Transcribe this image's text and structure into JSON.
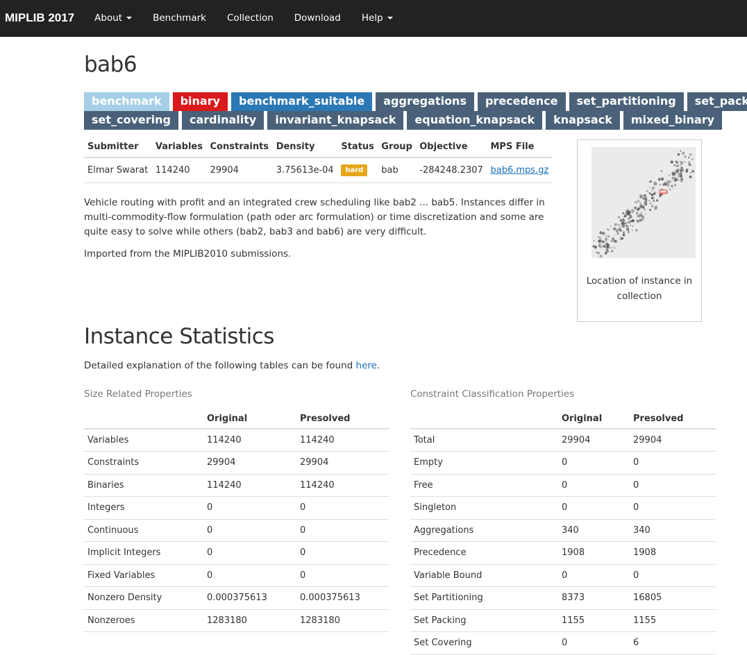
{
  "nav": {
    "brand": "MIPLIB 2017",
    "items": [
      {
        "label": "About",
        "dropdown": true
      },
      {
        "label": "Benchmark",
        "dropdown": false
      },
      {
        "label": "Collection",
        "dropdown": false
      },
      {
        "label": "Download",
        "dropdown": false
      },
      {
        "label": "Help",
        "dropdown": true
      }
    ]
  },
  "title": "bab6",
  "tags": [
    [
      {
        "label": "benchmark",
        "color": "#a4cfe6"
      },
      {
        "label": "binary",
        "color": "#d9191c"
      },
      {
        "label": "benchmark_suitable",
        "color": "#2a78b5"
      },
      {
        "label": "aggregations",
        "color": "#4a6179"
      },
      {
        "label": "precedence",
        "color": "#4a6179"
      },
      {
        "label": "set_partitioning",
        "color": "#4a6179"
      },
      {
        "label": "set_packing",
        "color": "#4a6179"
      }
    ],
    [
      {
        "label": "set_covering",
        "color": "#4a6179"
      },
      {
        "label": "cardinality",
        "color": "#4a6179"
      },
      {
        "label": "invariant_knapsack",
        "color": "#4a6179"
      },
      {
        "label": "equation_knapsack",
        "color": "#4a6179"
      },
      {
        "label": "knapsack",
        "color": "#4a6179"
      },
      {
        "label": "mixed_binary",
        "color": "#4a6179"
      }
    ]
  ],
  "info": {
    "headers": [
      "Submitter",
      "Variables",
      "Constraints",
      "Density",
      "Status",
      "Group",
      "Objective",
      "MPS File"
    ],
    "row": {
      "submitter": "Elmar Swarat",
      "variables": "114240",
      "constraints": "29904",
      "density": "3.75613e-04",
      "status": "hard",
      "group": "bab",
      "objective": "-284248.2307",
      "mps": "bab6.mps.gz"
    }
  },
  "description": [
    "Vehicle routing with profit and an integrated crew scheduling like bab2 ... bab5. Instances differ in multi-commodity-flow formulation (path oder arc formulation) or time discretization and some are quite easy to solve while others (bab2, bab3 and bab6) are very difficult.",
    "Imported from the MIPLIB2010 submissions."
  ],
  "figure": {
    "caption": "Location of instance in collection",
    "highlight_label": "bab6"
  },
  "stats_section": {
    "heading": "Instance Statistics",
    "explain_prefix": "Detailed explanation of the following tables can be found ",
    "explain_link": "here",
    "explain_suffix": "."
  },
  "size_table": {
    "label": "Size Related Properties",
    "headers": [
      "",
      "Original",
      "Presolved"
    ],
    "rows": [
      [
        "Variables",
        "114240",
        "114240"
      ],
      [
        "Constraints",
        "29904",
        "29904"
      ],
      [
        "Binaries",
        "114240",
        "114240"
      ],
      [
        "Integers",
        "0",
        "0"
      ],
      [
        "Continuous",
        "0",
        "0"
      ],
      [
        "Implicit Integers",
        "0",
        "0"
      ],
      [
        "Fixed Variables",
        "0",
        "0"
      ],
      [
        "Nonzero Density",
        "0.000375613",
        "0.000375613"
      ],
      [
        "Nonzeroes",
        "1283180",
        "1283180"
      ]
    ]
  },
  "constraint_table": {
    "label": "Constraint Classification Properties",
    "headers": [
      "",
      "Original",
      "Presolved"
    ],
    "rows": [
      [
        "Total",
        "29904",
        "29904"
      ],
      [
        "Empty",
        "0",
        "0"
      ],
      [
        "Free",
        "0",
        "0"
      ],
      [
        "Singleton",
        "0",
        "0"
      ],
      [
        "Aggregations",
        "340",
        "340"
      ],
      [
        "Precedence",
        "1908",
        "1908"
      ],
      [
        "Variable Bound",
        "0",
        "0"
      ],
      [
        "Set Partitioning",
        "8373",
        "16805"
      ],
      [
        "Set Packing",
        "1155",
        "1155"
      ],
      [
        "Set Covering",
        "0",
        "6"
      ]
    ]
  }
}
